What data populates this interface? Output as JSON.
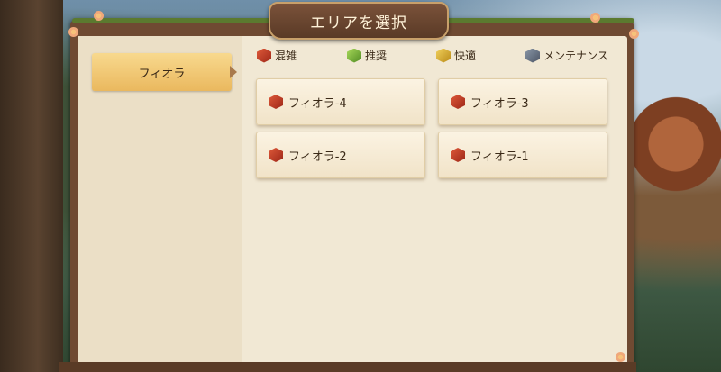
{
  "dialog": {
    "title": "エリアを選択"
  },
  "regions": [
    {
      "label": "フィオラ",
      "selected": true
    }
  ],
  "legend": [
    {
      "label": "混雑",
      "color": "red"
    },
    {
      "label": "推奨",
      "color": "green"
    },
    {
      "label": "快適",
      "color": "yellow"
    },
    {
      "label": "メンテナンス",
      "color": "gray"
    }
  ],
  "servers": [
    {
      "name": "フィオラ-4",
      "status": "red"
    },
    {
      "name": "フィオラ-3",
      "status": "red"
    },
    {
      "name": "フィオラ-2",
      "status": "red"
    },
    {
      "name": "フィオラ-1",
      "status": "red"
    }
  ],
  "colors": {
    "frame": "#6f4a32",
    "panel": "#f1e8d4",
    "selected_tab": "#f3cb76",
    "busy": "#c0392b"
  }
}
